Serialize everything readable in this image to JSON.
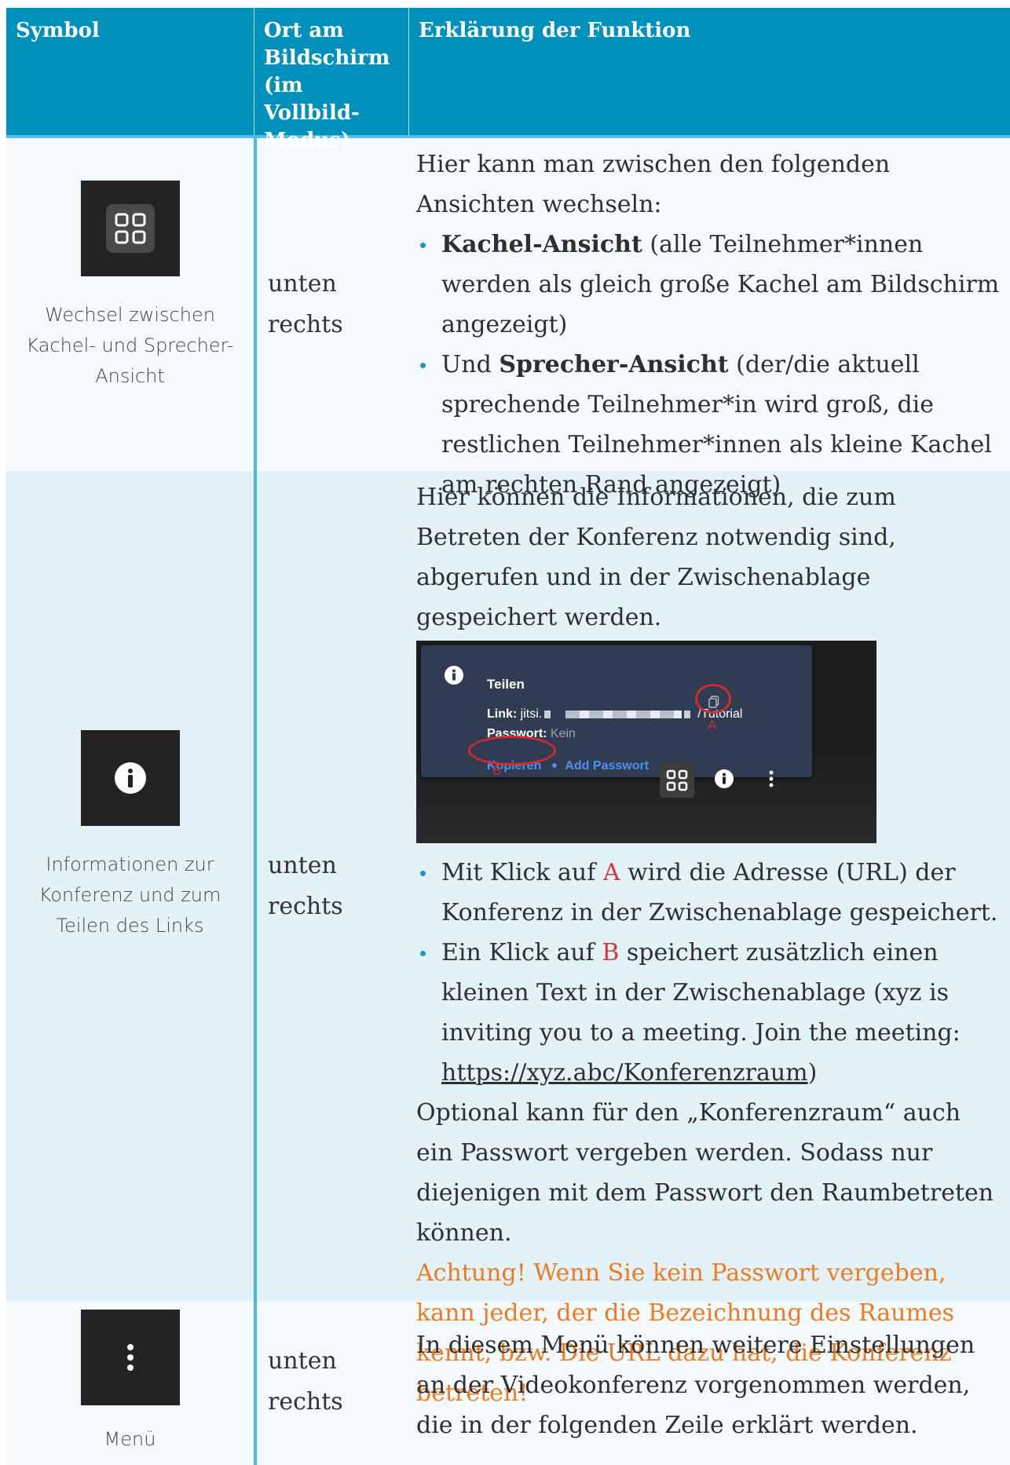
{
  "header": {
    "symbol": "Symbol",
    "ort": "Ort am Bildschirm (im Vollbild-Modus)",
    "erklaerung": "Erklärung der Funktion"
  },
  "rows": [
    {
      "icon": "grid-view-icon",
      "caption": "Wechsel zwischen Kachel- und Sprecher-Ansicht",
      "ort_line1": "unten",
      "ort_line2": "rechts",
      "intro": "Hier kann man zwischen den folgenden Ansichten wechseln:",
      "bullets": [
        {
          "bold": "Kachel-Ansicht",
          "rest": " (alle Teilnehmer*innen werden als gleich große Kachel am Bildschirm angezeigt)"
        },
        {
          "pre": "Und ",
          "bold": "Sprecher-Ansicht",
          "rest": " (der/die aktuell sprechende Teilnehmer*in wird groß, die restlichen Teilnehmer*innen als kleine Kachel am rechten Rand angezeigt)"
        }
      ]
    },
    {
      "icon": "info-icon",
      "caption": "Informationen zur Konferenz und zum Teilen des Links",
      "ort_line1": "unten",
      "ort_line2": "rechts",
      "intro": "Hier können die Informationen, die zum Betreten der Konferenz notwendig sind, abgerufen und in der Zwischenablage gespeichert werden.",
      "screenshot": {
        "title": "Teilen",
        "link_label": "Link:",
        "link_start": "jitsi.",
        "link_end": "/Tutorial",
        "password_label": "Passwort:",
        "password_value": "Kein",
        "copy_label": "Kopieren",
        "add_password_label": "Add Passwort",
        "mark_a": "A",
        "mark_b": "B"
      },
      "bullets": [
        {
          "pre": "Mit Klick auf ",
          "red": "A",
          "rest": " wird die Adresse (URL) der Konferenz in der Zwischenablage gespeichert."
        },
        {
          "pre": "Ein Klick auf ",
          "red": "B",
          "rest": " speichert zusätzlich einen kleinen Text in der Zwischenablage (xyz is inviting you to a meeting. Join the meeting: ",
          "link": "https://xyz.abc/Konferenzraum",
          "tail": ")"
        }
      ],
      "optional": "Optional kann für den „Konferenzraum“ auch ein Passwort vergeben werden. Sodass nur diejenigen mit dem Passwort den Raumbetreten können.",
      "warning": "Achtung! Wenn Sie kein Passwort vergeben, kann jeder, der die Bezeichnung des Raumes kennt, bzw. Die URL dazu hat, die Konferenz betreten!"
    },
    {
      "icon": "more-vertical-icon",
      "caption": "Menü",
      "ort_line1": "unten",
      "ort_line2": "rechts",
      "intro": "In diesem Menü können weitere Einstellungen an der Videokonferenz vorgenommen werden, die in der folgenden Zeile erklärt werden."
    }
  ]
}
